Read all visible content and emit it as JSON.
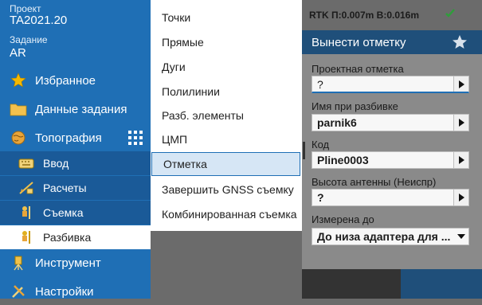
{
  "sidebar": {
    "project_label": "Проект",
    "project_value": "TA2021.20",
    "task_label": "Задание",
    "task_value": "AR",
    "items": [
      {
        "label": "Избранное",
        "icon": "star-icon"
      },
      {
        "label": "Данные задания",
        "icon": "folder-icon"
      },
      {
        "label": "Топография",
        "icon": "globe-icon"
      },
      {
        "label": "Ввод",
        "icon": "keyboard-icon"
      },
      {
        "label": "Расчеты",
        "icon": "calculate-icon"
      },
      {
        "label": "Съемка",
        "icon": "survey-icon"
      },
      {
        "label": "Разбивка",
        "icon": "stakeout-icon"
      },
      {
        "label": "Инструмент",
        "icon": "instrument-icon"
      },
      {
        "label": "Настройки",
        "icon": "settings-icon"
      }
    ]
  },
  "menu": {
    "items": [
      "Точки",
      "Прямые",
      "Дуги",
      "Полилинии",
      "Разб. элементы",
      "ЦМП",
      "Отметка",
      "Завершить GNSS съемку",
      "Комбинированная съемка"
    ],
    "selected": "Отметка"
  },
  "status": {
    "rtk_text": "RTK П:0.007m В:0.016m"
  },
  "panel": {
    "title": "Вынести отметку",
    "fields": [
      {
        "label": "Проектная отметка",
        "value": "?"
      },
      {
        "label": "Имя при разбивке",
        "value": "parnik6"
      },
      {
        "label": "Код",
        "value": "Pline0003"
      },
      {
        "label": "Высота антенны (Неиспр)",
        "value": "?"
      },
      {
        "label": "Измерена до",
        "value": "До низа адаптера для ..."
      }
    ]
  },
  "colors": {
    "sidebar_bg": "#1f6fb5",
    "panel_title_bg": "#1f4f7a",
    "check_green": "#2e9e3a"
  }
}
